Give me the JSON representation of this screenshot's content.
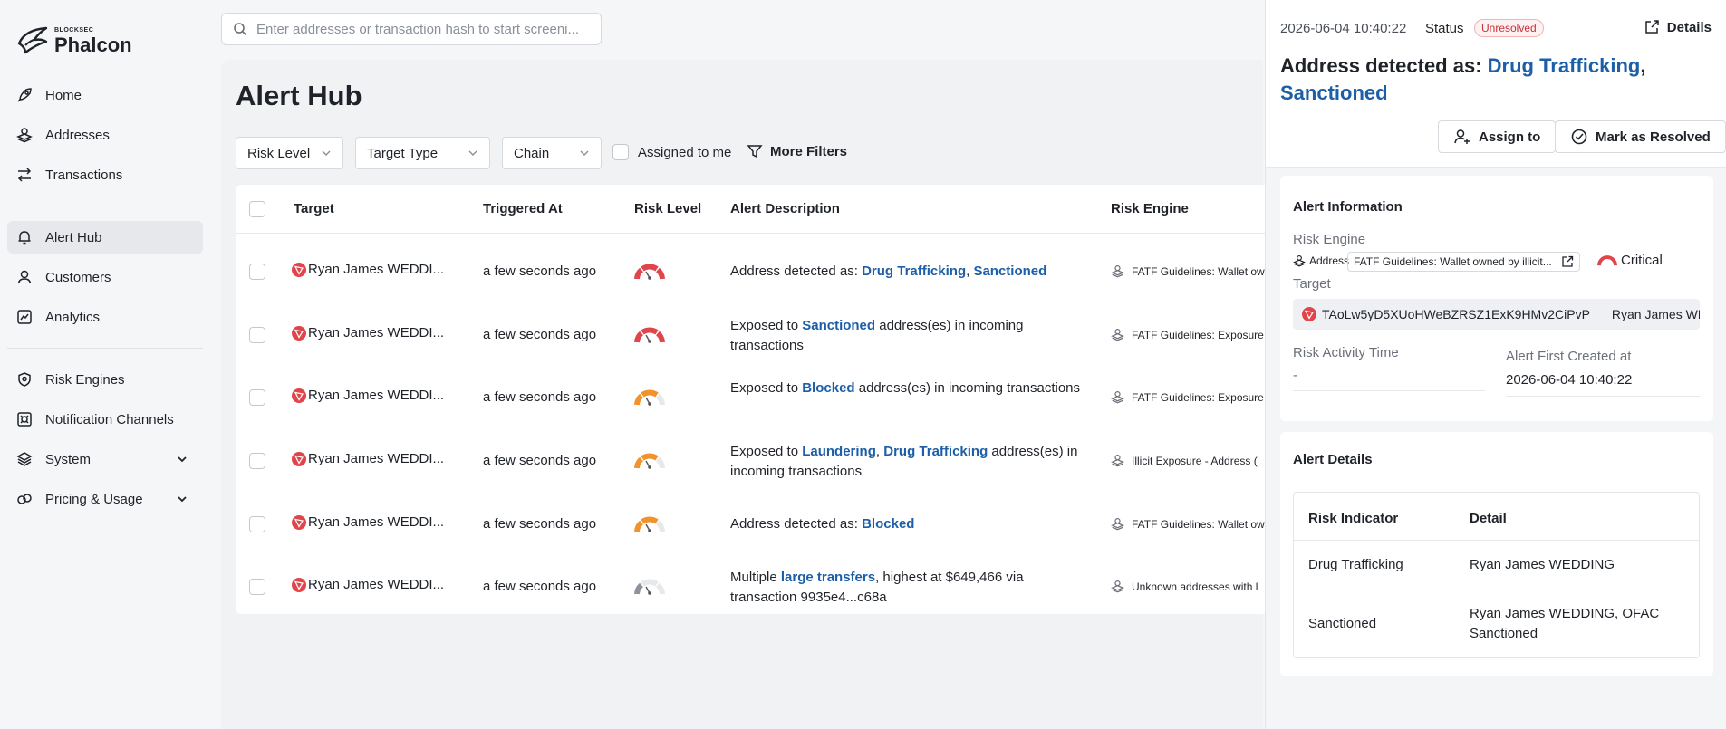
{
  "brand": {
    "small": "BLOCKSEC",
    "big": "Phalcon"
  },
  "search": {
    "placeholder": "Enter addresses or transaction hash to start screeni..."
  },
  "nav": {
    "home": "Home",
    "addresses": "Addresses",
    "transactions": "Transactions",
    "alert_hub": "Alert Hub",
    "customers": "Customers",
    "analytics": "Analytics",
    "risk_engines": "Risk Engines",
    "notification_channels": "Notification Channels",
    "system": "System",
    "pricing": "Pricing & Usage"
  },
  "page": {
    "title": "Alert Hub",
    "filters": {
      "risk_level": "Risk Level",
      "target_type": "Target Type",
      "chain": "Chain",
      "assigned": "Assigned to me",
      "more": "More Filters"
    }
  },
  "table": {
    "headers": {
      "target": "Target",
      "triggered": "Triggered At",
      "risk": "Risk Level",
      "desc": "Alert Description",
      "engine": "Risk Engine"
    },
    "rows": [
      {
        "target": "Ryan James WEDDI...",
        "time": "a few seconds ago",
        "risk": "critical",
        "desc": [
          {
            "t": "Address detected as: "
          },
          {
            "t": "Drug Trafficking",
            "l": 1
          },
          {
            "t": ", "
          },
          {
            "t": "Sanctioned",
            "l": 1
          }
        ],
        "engine": "FATF Guidelines: Wallet ow"
      },
      {
        "target": "Ryan James WEDDI...",
        "time": "a few seconds ago",
        "risk": "critical",
        "desc": [
          {
            "t": "Exposed to "
          },
          {
            "t": "Sanctioned",
            "l": 1
          },
          {
            "t": " address(es) in incoming transactions"
          }
        ],
        "engine": "FATF Guidelines: Exposure"
      },
      {
        "target": "Ryan James WEDDI...",
        "time": "a few seconds ago",
        "risk": "high",
        "desc": [
          {
            "t": "Exposed to "
          },
          {
            "t": "Blocked",
            "l": 1
          },
          {
            "t": " address(es) in incoming transactions"
          }
        ],
        "engine": "FATF Guidelines: Exposure"
      },
      {
        "target": "Ryan James WEDDI...",
        "time": "a few seconds ago",
        "risk": "high",
        "desc": [
          {
            "t": "Exposed to "
          },
          {
            "t": "Laundering",
            "l": 1
          },
          {
            "t": ", "
          },
          {
            "t": "Drug Trafficking",
            "l": 1
          },
          {
            "t": " address(es) in incoming transactions"
          }
        ],
        "engine": "Illicit Exposure - Address ("
      },
      {
        "target": "Ryan James WEDDI...",
        "time": "a few seconds ago",
        "risk": "high",
        "desc": [
          {
            "t": "Address detected as: "
          },
          {
            "t": "Blocked",
            "l": 1
          }
        ],
        "engine": "FATF Guidelines: Wallet ow"
      },
      {
        "target": "Ryan James WEDDI...",
        "time": "a few seconds ago",
        "risk": "low",
        "desc": [
          {
            "t": "Multiple "
          },
          {
            "t": "large transfers",
            "l": 1
          },
          {
            "t": ", highest at $649,466 via transaction 9935e4...c68a"
          }
        ],
        "engine": "Unknown addresses with l"
      }
    ]
  },
  "panel": {
    "date": "2026-06-04 10:40:22",
    "status_label": "Status",
    "status": "Unresolved",
    "details": "Details",
    "title_prefix": "Address detected as: ",
    "title_link1": "Drug Trafficking",
    "title_sep": ",",
    "title_link2": "Sanctioned",
    "assign": "Assign to",
    "resolve": "Mark as Resolved",
    "info": {
      "title": "Alert Information",
      "risk_engine_label": "Risk Engine",
      "engine_type": "Address",
      "engine_name": "FATF Guidelines: Wallet owned by illicit...",
      "severity": "Critical",
      "target_label": "Target",
      "target_address": "TAoLw5yD5XUoHWeBZRSZ1ExK9HMv2CiPvP",
      "target_name": "Ryan James WEDDING",
      "activity_label": "Risk Activity Time",
      "activity_value": "-",
      "created_label": "Alert First Created at",
      "created_value": "2026-06-04 10:40:22"
    },
    "alert_details": {
      "title": "Alert Details",
      "col1": "Risk Indicator",
      "col2": "Detail",
      "rows": [
        {
          "indicator": "Drug Trafficking",
          "detail": "Ryan James WEDDING"
        },
        {
          "indicator": "Sanctioned",
          "detail": "Ryan James WEDDING, OFAC Sanctioned"
        }
      ]
    }
  },
  "colors": {
    "link": "#1c5fa8",
    "critical": "#e0454c",
    "high": "#f0932b",
    "low": "#8d939c"
  }
}
